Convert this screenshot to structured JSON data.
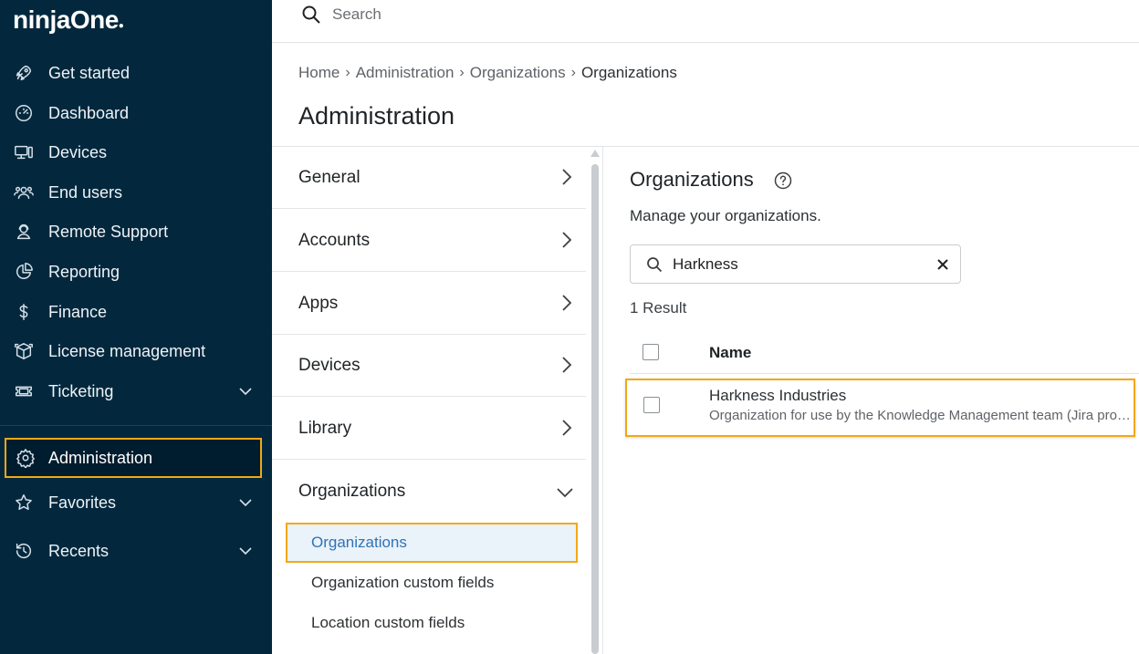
{
  "app": {
    "logo_text": "ninjaOne"
  },
  "sidebar": {
    "items": [
      {
        "label": "Get started",
        "icon": "rocket-icon"
      },
      {
        "label": "Dashboard",
        "icon": "gauge-icon"
      },
      {
        "label": "Devices",
        "icon": "devices-icon"
      },
      {
        "label": "End users",
        "icon": "users-icon"
      },
      {
        "label": "Remote Support",
        "icon": "headset-icon"
      },
      {
        "label": "Reporting",
        "icon": "pie-chart-icon"
      },
      {
        "label": "Finance",
        "icon": "dollar-icon"
      },
      {
        "label": "License management",
        "icon": "box-icon"
      },
      {
        "label": "Ticketing",
        "icon": "ticket-icon",
        "expandable": true
      }
    ],
    "active": {
      "label": "Administration",
      "icon": "gear-icon"
    },
    "bottom_items": [
      {
        "label": "Favorites",
        "icon": "star-icon",
        "expandable": true
      },
      {
        "label": "Recents",
        "icon": "history-icon",
        "expandable": true
      }
    ]
  },
  "topbar": {
    "search_placeholder": "Search"
  },
  "breadcrumb": [
    "Home",
    "Administration",
    "Organizations",
    "Organizations"
  ],
  "page": {
    "title": "Administration"
  },
  "menu": {
    "items": [
      "General",
      "Accounts",
      "Apps",
      "Devices",
      "Library"
    ],
    "open_section": "Organizations",
    "sub_items": {
      "active": "Organizations",
      "others": [
        "Organization custom fields",
        "Location custom fields"
      ]
    }
  },
  "content": {
    "title": "Organizations",
    "subtitle": "Manage your organizations.",
    "search_value": "Harkness",
    "result_count": "1 Result",
    "columns": [
      "Name"
    ],
    "rows": [
      {
        "name": "Harkness Industries",
        "description": "Organization for use by the Knowledge Management team (Jira project KMT)"
      }
    ]
  },
  "colors": {
    "sidebar_bg": "#03283e",
    "highlight": "#f2a814",
    "link": "#2f73b6"
  }
}
